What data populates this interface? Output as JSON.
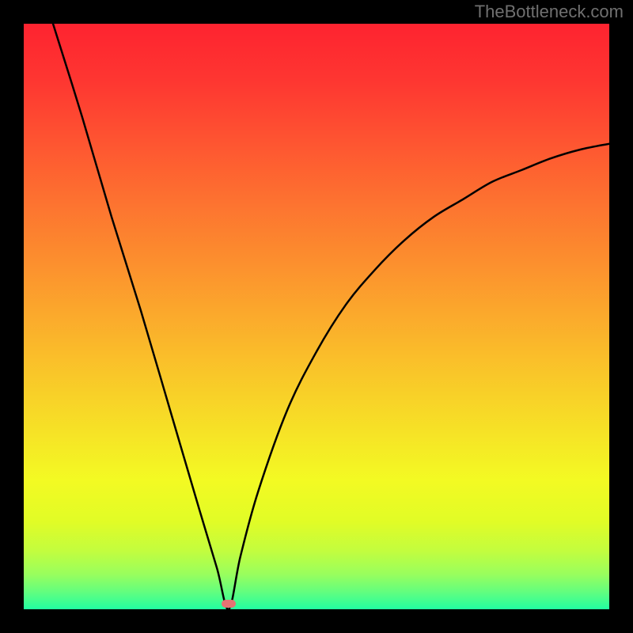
{
  "watermark": "TheBottleneck.com",
  "colors": {
    "frame": "#000000",
    "gradient_stops": [
      {
        "offset": 0.0,
        "color": "#fe2330"
      },
      {
        "offset": 0.1,
        "color": "#fe3731"
      },
      {
        "offset": 0.2,
        "color": "#fe5431"
      },
      {
        "offset": 0.3,
        "color": "#fd7130"
      },
      {
        "offset": 0.4,
        "color": "#fc8d2e"
      },
      {
        "offset": 0.5,
        "color": "#fbaa2c"
      },
      {
        "offset": 0.6,
        "color": "#f9c729"
      },
      {
        "offset": 0.7,
        "color": "#f6e326"
      },
      {
        "offset": 0.78,
        "color": "#f3fa23"
      },
      {
        "offset": 0.85,
        "color": "#e1fc26"
      },
      {
        "offset": 0.9,
        "color": "#c3fd3e"
      },
      {
        "offset": 0.94,
        "color": "#99fe5d"
      },
      {
        "offset": 0.97,
        "color": "#63fe7e"
      },
      {
        "offset": 1.0,
        "color": "#22fea1"
      }
    ],
    "curve": "#000000",
    "marker": "#e57373"
  },
  "chart_data": {
    "type": "line",
    "title": "",
    "xlabel": "",
    "ylabel": "",
    "xlim": [
      0,
      100
    ],
    "ylim": [
      0,
      100
    ],
    "minimum_x": 35,
    "marker": {
      "x": 35,
      "y": 1
    },
    "series": [
      {
        "name": "bottleneck-curve",
        "x": [
          5,
          10,
          15,
          20,
          25,
          30,
          33,
          35,
          37,
          40,
          45,
          50,
          55,
          60,
          65,
          70,
          75,
          80,
          85,
          90,
          95,
          100
        ],
        "y": [
          100,
          84,
          67,
          51,
          34,
          17,
          7,
          0,
          9,
          20,
          34,
          44,
          52,
          58,
          63,
          67,
          70,
          73,
          75,
          77,
          78.5,
          79.5
        ]
      }
    ]
  }
}
